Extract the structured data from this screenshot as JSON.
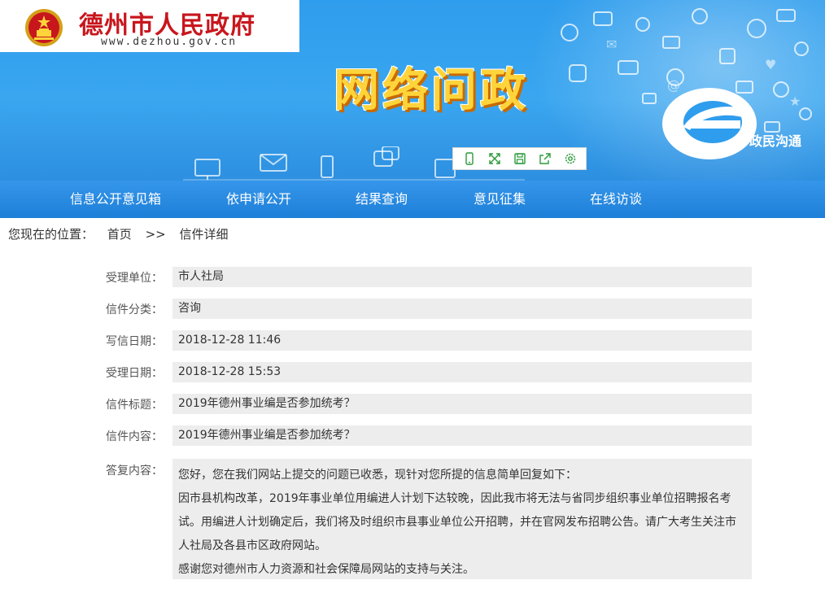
{
  "header": {
    "site_name": "德州市人民政府",
    "site_url": "www.dezhou.gov.cn",
    "banner_title": "网络问政",
    "brand_text": "政民沟通"
  },
  "toolbar": {
    "icons": [
      "mobile-icon",
      "fullscreen-icon",
      "save-icon",
      "share-icon",
      "settings-icon"
    ]
  },
  "nav": {
    "items": [
      {
        "label": "信息公开意见箱"
      },
      {
        "label": "依申请公开"
      },
      {
        "label": "结果查询"
      },
      {
        "label": "意见征集"
      },
      {
        "label": "在线访谈"
      }
    ]
  },
  "breadcrumb": {
    "prefix": "您现在的位置：",
    "home": "首页",
    "separator": ">>",
    "current": "信件详细"
  },
  "details": {
    "rows": [
      {
        "label": "受理单位：",
        "value": "市人社局"
      },
      {
        "label": "信件分类：",
        "value": "咨询"
      },
      {
        "label": "写信日期：",
        "value": "2018-12-28 11:46"
      },
      {
        "label": "受理日期：",
        "value": "2018-12-28 15:53"
      },
      {
        "label": "信件标题：",
        "value": "2019年德州事业编是否参加统考？"
      },
      {
        "label": "信件内容：",
        "value": "2019年德州事业编是否参加统考？"
      }
    ],
    "reply_label": "答复内容：",
    "reply_lines": [
      "您好，您在我们网站上提交的问题已收悉，现针对您所提的信息简单回复如下：",
      "因市县机构改革，2019年事业单位用编进人计划下达较晚，因此我市将无法与省同步组织事业单位招聘报名考",
      "试。用编进人计划确定后，我们将及时组织市县事业单位公开招聘，并在官网发布招聘公告。请广大考生关注市",
      "人社局及各县市区政府网站。",
      "感谢您对德州市人力资源和社会保障局网站的支持与关注。"
    ]
  },
  "colors": {
    "banner_blue": "#2f9ded",
    "nav_blue": "#1e7fd8",
    "site_red": "#c8161d",
    "title_yellow": "#ffd43a",
    "row_bg": "#ededed"
  }
}
